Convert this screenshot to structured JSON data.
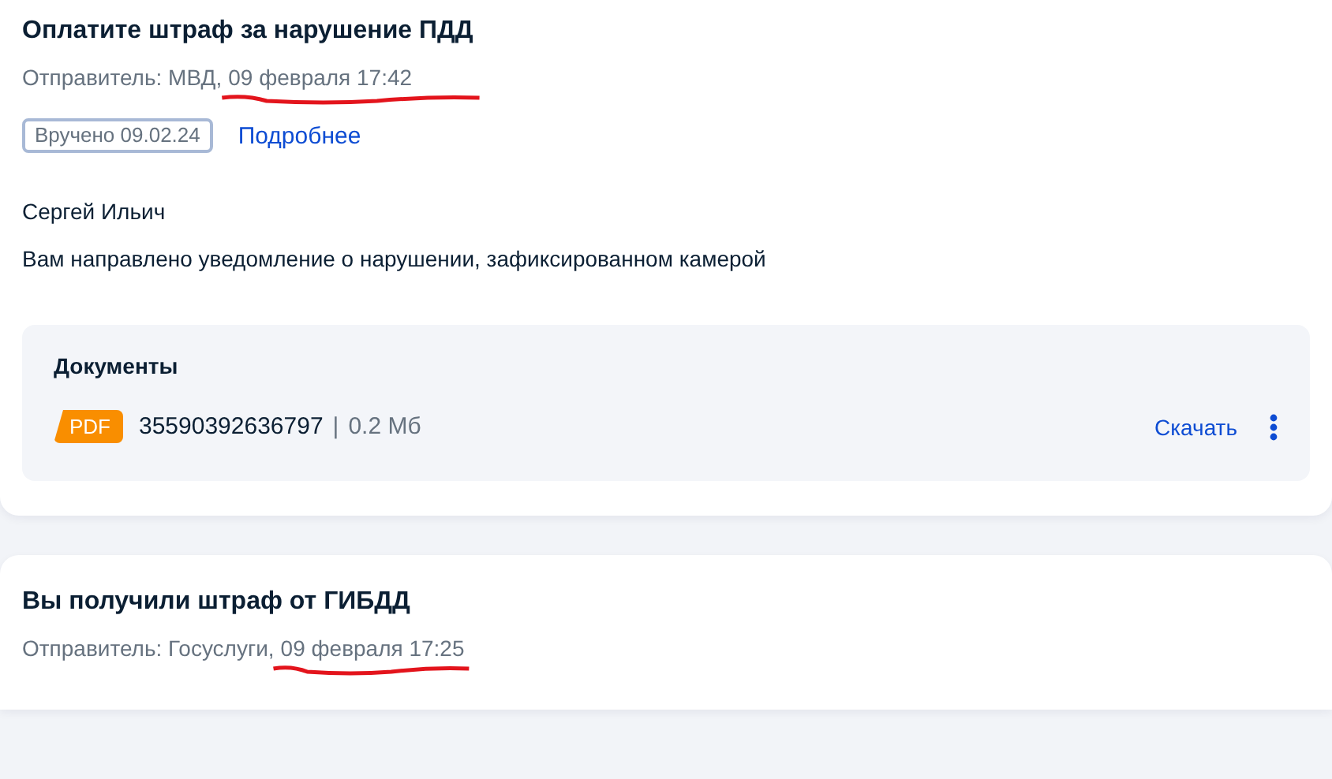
{
  "messages": [
    {
      "title": "Оплатите штраф за нарушение ПДД",
      "sender": "Отправитель: МВД,",
      "date": "09 февраля 17:42",
      "date_underlined": true,
      "status_badge": "Вручено 09.02.24",
      "details_link": "Подробнее",
      "recipient": "Сергей Ильич",
      "body": "Вам направлено уведомление о нарушении, зафиксированном камерой",
      "documents": {
        "title": "Документы",
        "files": [
          {
            "type": "PDF",
            "name": "35590392636797",
            "separator": "|",
            "size": "0.2 Мб",
            "download": "Скачать"
          }
        ]
      }
    },
    {
      "title": "Вы получили штраф от ГИБДД",
      "sender": "Отправитель: Госуслуги,",
      "date": "09 февраля 17:25",
      "date_underlined": true
    }
  ]
}
